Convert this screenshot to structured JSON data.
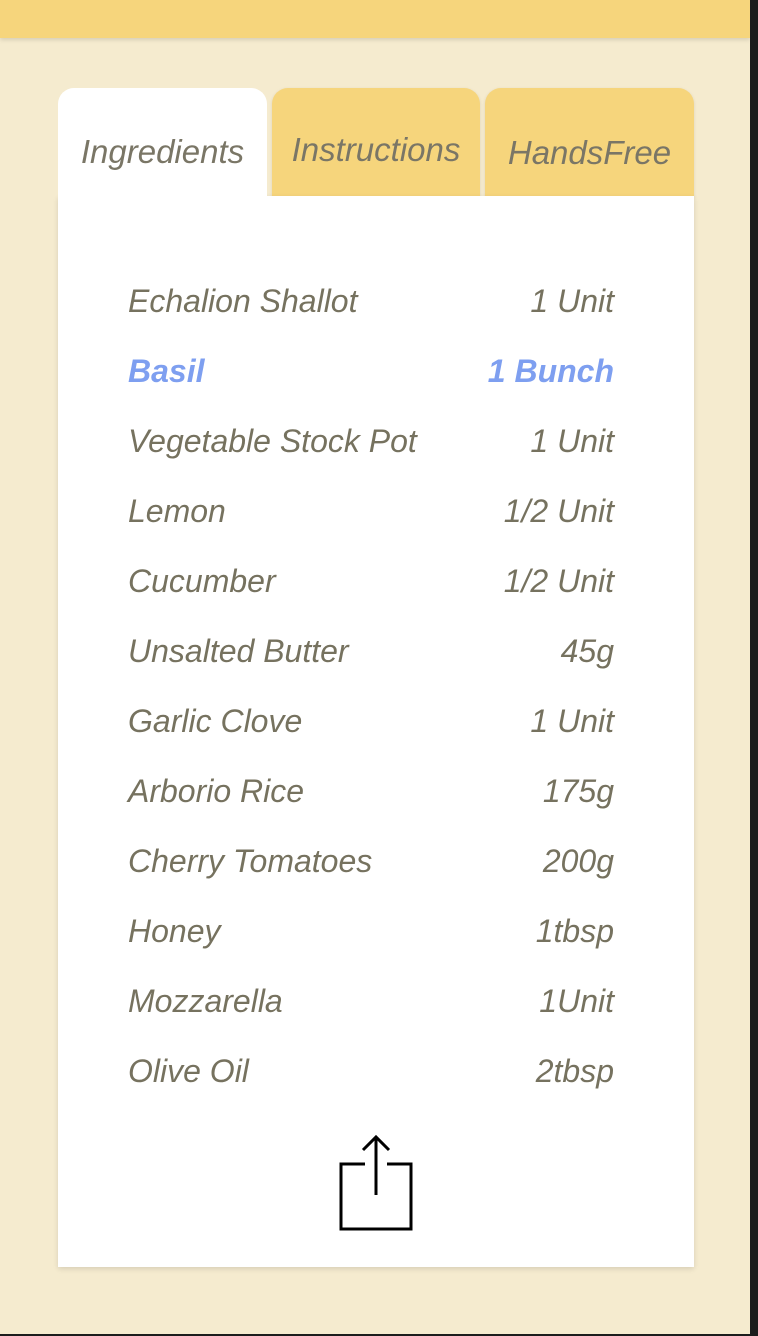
{
  "tabs": [
    {
      "label": "Ingredients",
      "active": true
    },
    {
      "label": "Instructions",
      "active": false
    },
    {
      "label": "HandsFree",
      "active": false
    }
  ],
  "ingredients": [
    {
      "name": "Echalion Shallot",
      "qty": "1 Unit"
    },
    {
      "name": "Basil",
      "qty": "1 Bunch",
      "highlighted": true
    },
    {
      "name": "Vegetable Stock Pot",
      "qty": "1 Unit"
    },
    {
      "name": "Lemon",
      "qty": "1/2 Unit"
    },
    {
      "name": "Cucumber",
      "qty": "1/2 Unit"
    },
    {
      "name": "Unsalted Butter",
      "qty": "45g"
    },
    {
      "name": "Garlic Clove",
      "qty": "1 Unit"
    },
    {
      "name": "Arborio Rice",
      "qty": "175g"
    },
    {
      "name": "Cherry Tomatoes",
      "qty": "200g"
    },
    {
      "name": "Honey",
      "qty": "1tbsp"
    },
    {
      "name": "Mozzarella",
      "qty": "1Unit"
    },
    {
      "name": "Olive Oil",
      "qty": "2tbsp"
    }
  ],
  "share": {
    "icon": "share-icon"
  },
  "colors": {
    "top_bar": "#f6d57c",
    "background": "#f5ebcf",
    "tab_inactive": "#f6d57c",
    "text": "#76725f",
    "highlight": "#7e9ff0"
  }
}
